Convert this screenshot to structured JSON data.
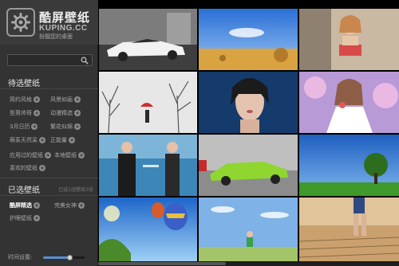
{
  "app": {
    "title": "酷屏壁纸",
    "subtitle": "KUPING.CC",
    "slogan": "扮靓您的桌面"
  },
  "search": {
    "placeholder": "",
    "value": ""
  },
  "pending": {
    "header": "待选壁纸",
    "categories": [
      {
        "label": "简约风格"
      },
      {
        "label": "风景如画"
      },
      {
        "label": "型男帅哥"
      },
      {
        "label": "动漫精选"
      },
      {
        "label": "3月日历"
      },
      {
        "label": "繁花似锦"
      },
      {
        "label": "萌系天然呆"
      },
      {
        "label": "正能量"
      }
    ],
    "extras": [
      {
        "label": "应用过的壁纸"
      },
      {
        "label": "本地壁纸"
      },
      {
        "label": "喜欢的壁纸"
      }
    ]
  },
  "selected": {
    "header": "已选壁纸",
    "stats": "已选1组壁纸3张",
    "items": [
      {
        "label": "酷屏精选",
        "active": true
      },
      {
        "label": "完美女神",
        "active": false
      },
      {
        "label": "护眼壁纸",
        "active": false
      }
    ]
  },
  "settings": {
    "label": "时间设置:",
    "slider_value": 0.65
  },
  "icons": {
    "logo": "gear-icon",
    "search": "search-icon",
    "add": "plus-circle-icon"
  },
  "colors": {
    "sidebar_bg": "#333333",
    "accent": "#5a8fd0"
  }
}
